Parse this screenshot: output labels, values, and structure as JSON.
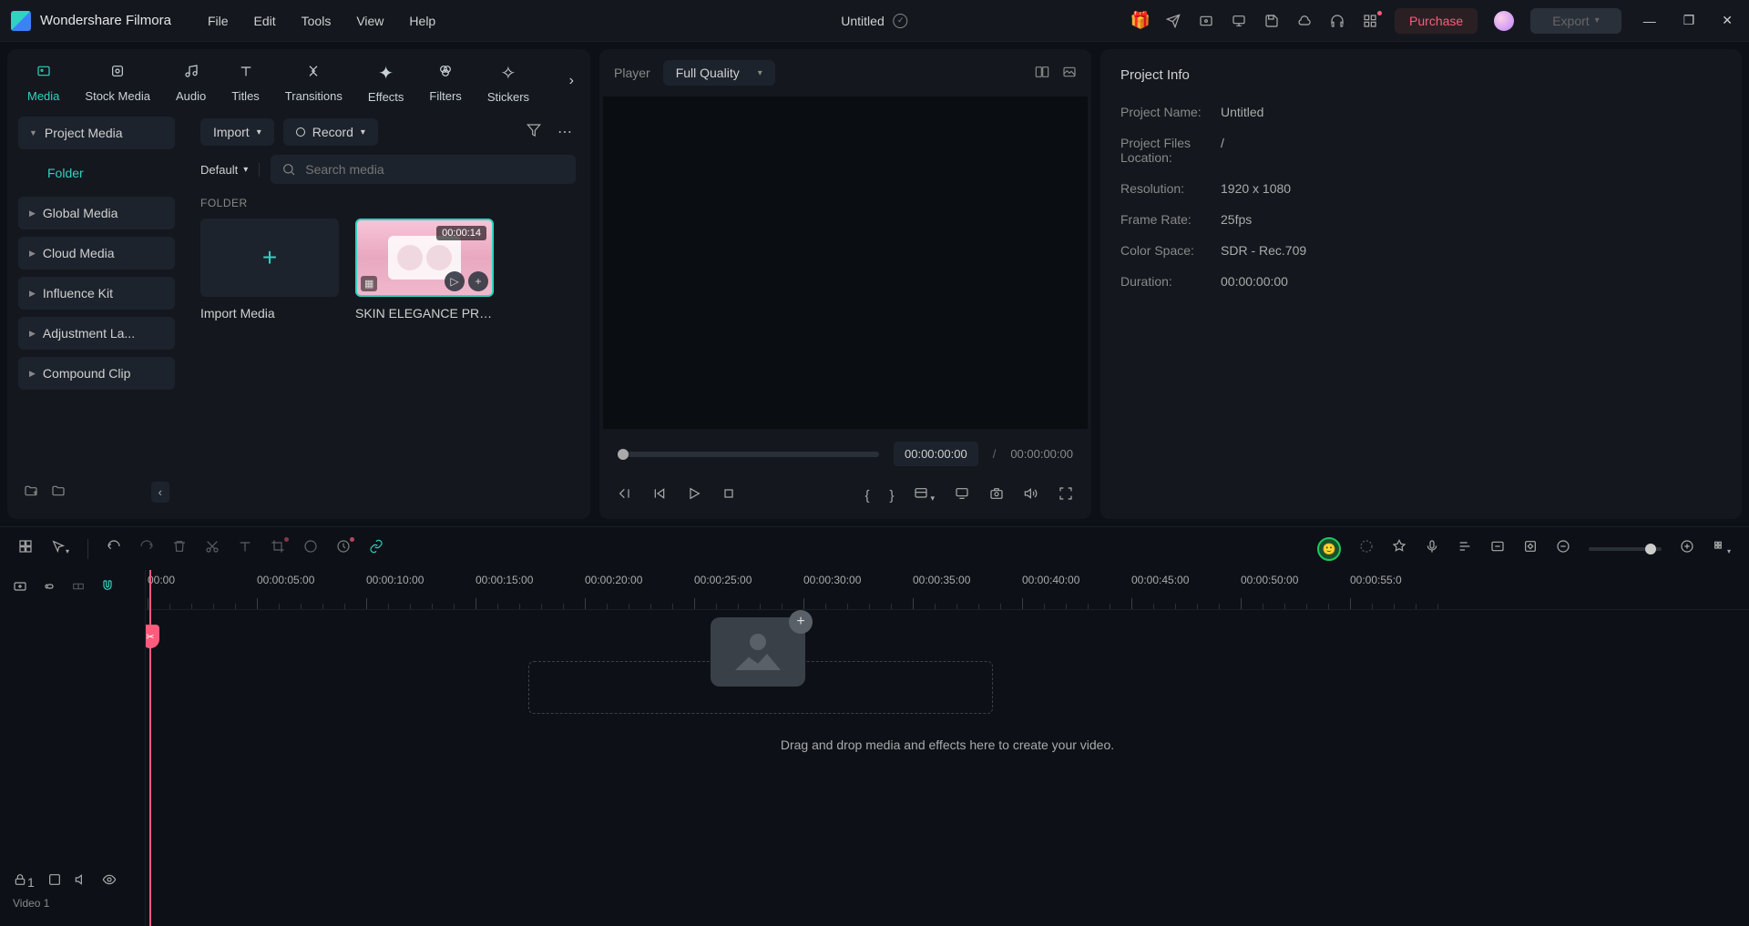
{
  "app": {
    "name": "Wondershare Filmora",
    "doc": "Untitled"
  },
  "menu": [
    "File",
    "Edit",
    "Tools",
    "View",
    "Help"
  ],
  "titlebar": {
    "purchase": "Purchase",
    "export": "Export"
  },
  "tabs": [
    {
      "label": "Media",
      "active": true
    },
    {
      "label": "Stock Media"
    },
    {
      "label": "Audio"
    },
    {
      "label": "Titles"
    },
    {
      "label": "Transitions"
    },
    {
      "label": "Effects"
    },
    {
      "label": "Filters"
    },
    {
      "label": "Stickers"
    }
  ],
  "sidebar": [
    {
      "label": "Project Media",
      "expanded": true
    },
    {
      "label": "Folder",
      "child": true,
      "active": true
    },
    {
      "label": "Global Media"
    },
    {
      "label": "Cloud Media"
    },
    {
      "label": "Influence Kit"
    },
    {
      "label": "Adjustment La..."
    },
    {
      "label": "Compound Clip"
    }
  ],
  "mediaTop": {
    "import": "Import",
    "record": "Record",
    "default": "Default",
    "searchPlaceholder": "Search media",
    "folderLabel": "FOLDER"
  },
  "thumbs": {
    "import": "Import Media",
    "clip": {
      "name": "SKIN ELEGANCE PRO...",
      "duration": "00:00:14"
    }
  },
  "player": {
    "label": "Player",
    "quality": "Full Quality",
    "cur": "00:00:00:00",
    "total": "00:00:00:00"
  },
  "info": {
    "title": "Project Info",
    "rows": [
      {
        "k": "Project Name:",
        "v": "Untitled"
      },
      {
        "k": "Project Files Location:",
        "v": "/"
      },
      {
        "k": "Resolution:",
        "v": "1920 x 1080"
      },
      {
        "k": "Frame Rate:",
        "v": "25fps"
      },
      {
        "k": "Color Space:",
        "v": "SDR - Rec.709"
      },
      {
        "k": "Duration:",
        "v": "00:00:00:00"
      }
    ]
  },
  "timeline": {
    "track": "Video 1",
    "dropText": "Drag and drop media and effects here to create your video.",
    "marks": [
      "00:00",
      "00:00:05:00",
      "00:00:10:00",
      "00:00:15:00",
      "00:00:20:00",
      "00:00:25:00",
      "00:00:30:00",
      "00:00:35:00",
      "00:00:40:00",
      "00:00:45:00",
      "00:00:50:00",
      "00:00:55:0"
    ]
  }
}
